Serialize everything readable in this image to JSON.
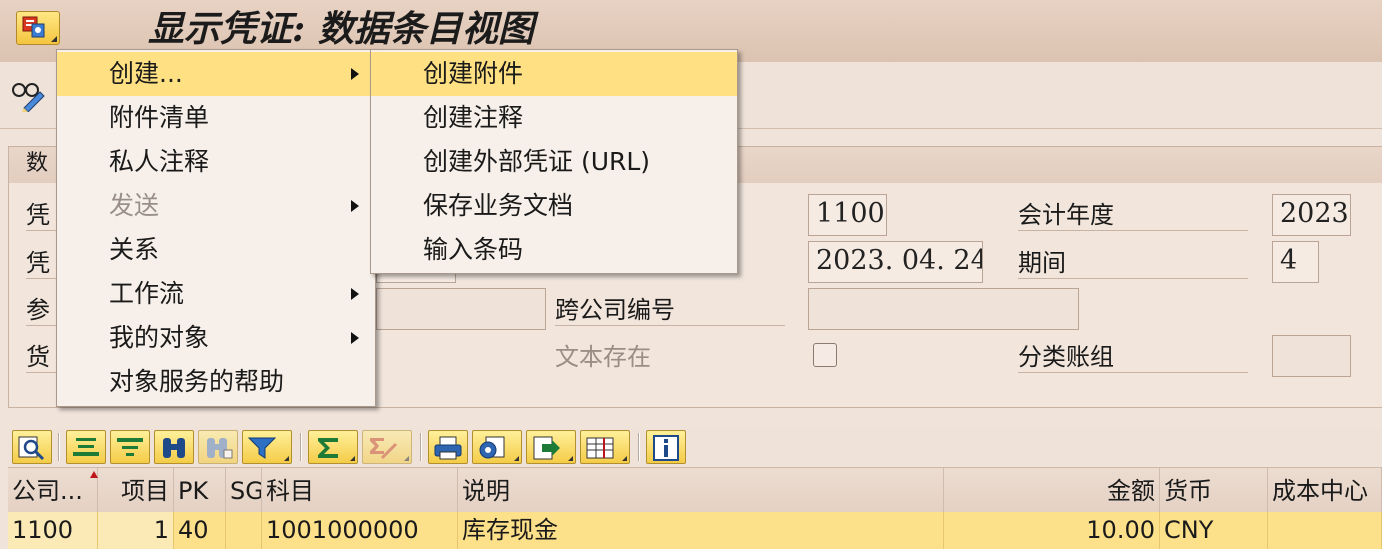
{
  "window": {
    "title": "显示凭证: 数据条目视图"
  },
  "header_group": {
    "title_visible": "数",
    "labels_left": [
      "凭",
      "凭",
      "参",
      "货"
    ],
    "company_code_value": "1100",
    "fiscal_year_label": "会计年度",
    "fiscal_year_value": "2023",
    "posting_date_value": "2023. 04. 24",
    "period_label": "期间",
    "period_value": "4",
    "cross_company_label": "跨公司编号",
    "cross_company_value": "",
    "text_exists_label": "文本存在",
    "ledger_group_label": "分类账组",
    "ledger_group_value": ""
  },
  "context_menu": {
    "items": [
      {
        "label": "创建...",
        "submenu": true,
        "selected": true,
        "enabled": true
      },
      {
        "label": "附件清单",
        "submenu": false,
        "selected": false,
        "enabled": true
      },
      {
        "label": "私人注释",
        "submenu": false,
        "selected": false,
        "enabled": true
      },
      {
        "label": "发送",
        "submenu": true,
        "selected": false,
        "enabled": false
      },
      {
        "label": "关系",
        "submenu": false,
        "selected": false,
        "enabled": true
      },
      {
        "label": "工作流",
        "submenu": true,
        "selected": false,
        "enabled": true
      },
      {
        "label": "我的对象",
        "submenu": true,
        "selected": false,
        "enabled": true
      },
      {
        "label": "对象服务的帮助",
        "submenu": false,
        "selected": false,
        "enabled": true
      }
    ]
  },
  "create_submenu": {
    "items": [
      {
        "label": "创建附件",
        "selected": true
      },
      {
        "label": "创建注释",
        "selected": false
      },
      {
        "label": "创建外部凭证 (URL)",
        "selected": false
      },
      {
        "label": "保存业务文档",
        "selected": false
      },
      {
        "label": "输入条码",
        "selected": false
      }
    ]
  },
  "grid": {
    "columns": [
      "公司...",
      "项目",
      "PK",
      "SG",
      "科目",
      "说明",
      "金额",
      "货币",
      "成本中心"
    ],
    "rows": [
      [
        "1100",
        "1",
        "40",
        "",
        "1001000000",
        "库存现金",
        "10.00",
        "CNY",
        ""
      ]
    ]
  },
  "icons": {
    "system_menu": "services-for-object-icon",
    "toolbar": "display-change-icon",
    "alv_toolbar": [
      "details-icon",
      "sort-ascending-icon",
      "sort-descending-icon",
      "find-icon",
      "find-next-icon",
      "filter-icon",
      "total-icon",
      "subtotals-icon",
      "print-icon",
      "views-icon",
      "export-icon",
      "layout-icon",
      "information-icon"
    ]
  },
  "colors": {
    "background": "#f0e3da",
    "highlight": "#ffe082",
    "button_yellow": "#f4cc47",
    "selected_row": "#fde08a"
  }
}
